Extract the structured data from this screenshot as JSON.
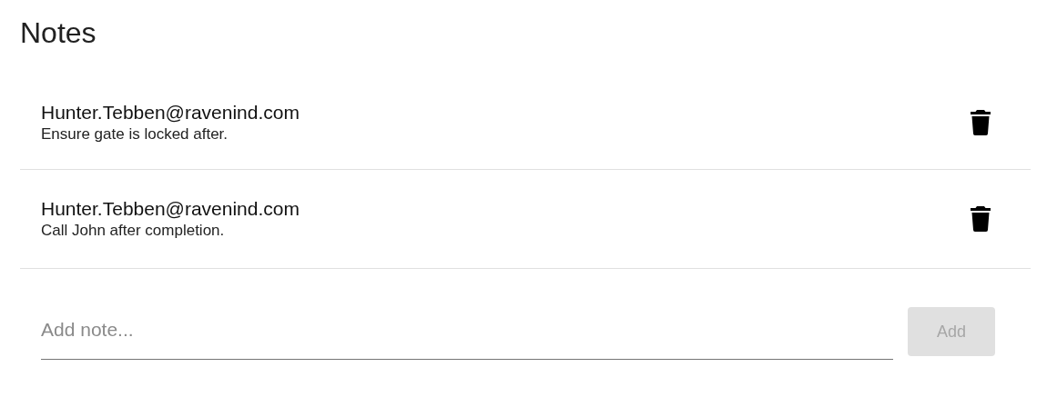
{
  "title": "Notes",
  "notes": [
    {
      "author": "Hunter.Tebben@ravenind.com",
      "text": "Ensure gate is locked after."
    },
    {
      "author": "Hunter.Tebben@ravenind.com",
      "text": "Call John after completion."
    }
  ],
  "new_note": {
    "placeholder": "Add note..."
  },
  "add_button": {
    "label": "Add",
    "disabled": true
  }
}
